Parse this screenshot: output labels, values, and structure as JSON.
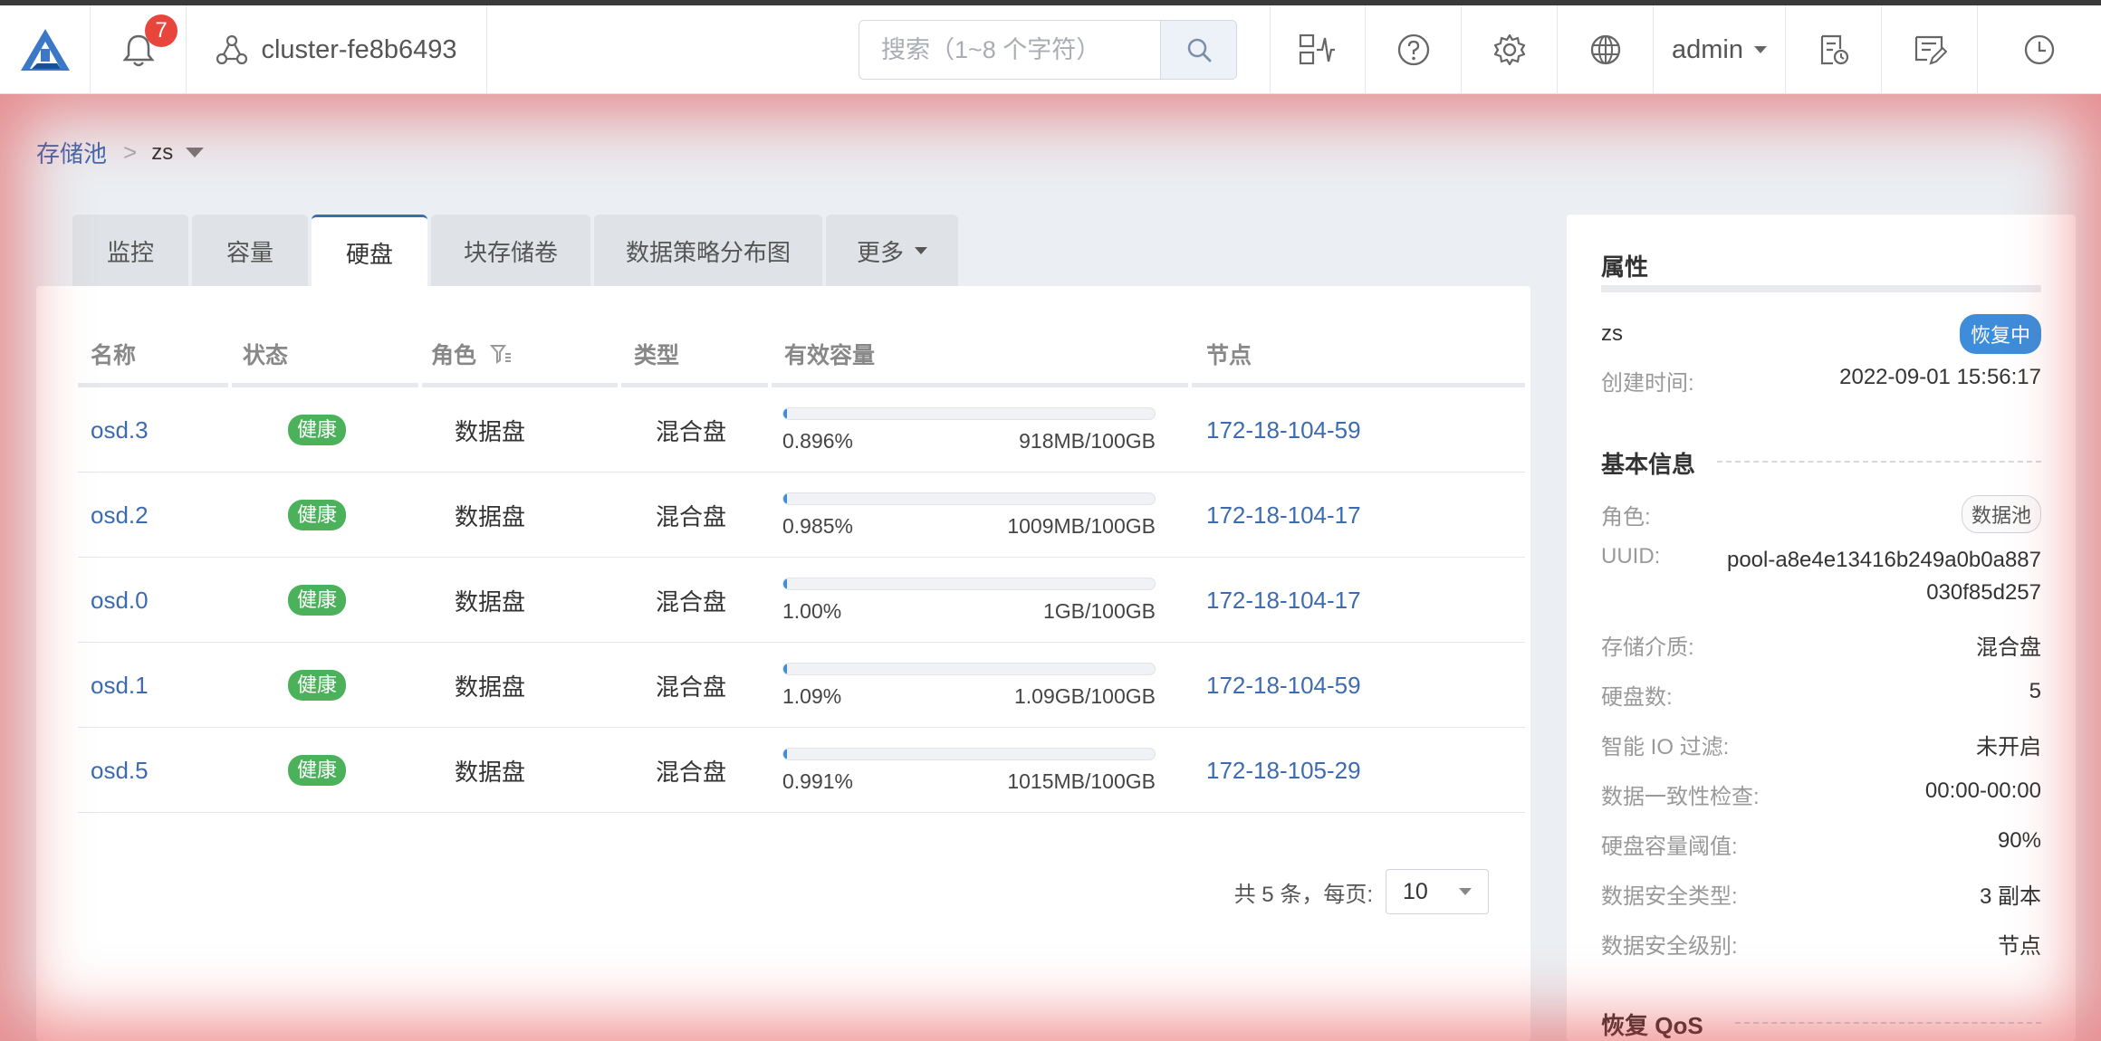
{
  "header": {
    "notification_count": "7",
    "cluster_name": "cluster-fe8b6493",
    "search_placeholder": "搜索（1~8 个字符）",
    "user": "admin"
  },
  "breadcrumb": {
    "parent": "存储池",
    "separator": ">",
    "current": "zs"
  },
  "tabs": [
    {
      "label": "监控"
    },
    {
      "label": "容量"
    },
    {
      "label": "硬盘"
    },
    {
      "label": "块存储卷"
    },
    {
      "label": "数据策略分布图"
    },
    {
      "label": "更多"
    }
  ],
  "active_tab": "硬盘",
  "table": {
    "columns": [
      "名称",
      "状态",
      "角色",
      "类型",
      "有效容量",
      "节点"
    ],
    "rows": [
      {
        "name": "osd.3",
        "status": "健康",
        "role": "数据盘",
        "type": "混合盘",
        "usage_pct": "0.896%",
        "usage_fraction": 0.00896,
        "usage_amount": "918MB/100GB",
        "node": "172-18-104-59"
      },
      {
        "name": "osd.2",
        "status": "健康",
        "role": "数据盘",
        "type": "混合盘",
        "usage_pct": "0.985%",
        "usage_fraction": 0.00985,
        "usage_amount": "1009MB/100GB",
        "node": "172-18-104-17"
      },
      {
        "name": "osd.0",
        "status": "健康",
        "role": "数据盘",
        "type": "混合盘",
        "usage_pct": "1.00%",
        "usage_fraction": 0.01,
        "usage_amount": "1GB/100GB",
        "node": "172-18-104-17"
      },
      {
        "name": "osd.1",
        "status": "健康",
        "role": "数据盘",
        "type": "混合盘",
        "usage_pct": "1.09%",
        "usage_fraction": 0.0109,
        "usage_amount": "1.09GB/100GB",
        "node": "172-18-104-59"
      },
      {
        "name": "osd.5",
        "status": "健康",
        "role": "数据盘",
        "type": "混合盘",
        "usage_pct": "0.991%",
        "usage_fraction": 0.00991,
        "usage_amount": "1015MB/100GB",
        "node": "172-18-105-29"
      }
    ]
  },
  "pagination": {
    "summary": "共 5 条，每页:",
    "page_size": "10"
  },
  "properties": {
    "title": "属性",
    "pool_name": "zs",
    "status_badge": "恢复中",
    "created_label": "创建时间:",
    "created_value": "2022-09-01 15:56:17",
    "basic_title": "基本信息",
    "role_label": "角色:",
    "role_value": "数据池",
    "uuid_label": "UUID:",
    "uuid_line1": "pool-a8e4e13416b249a0b0a887",
    "uuid_line2": "030f85d257",
    "fields": [
      {
        "label": "存储介质:",
        "value": "混合盘"
      },
      {
        "label": "硬盘数:",
        "value": "5"
      },
      {
        "label": "智能 IO 过滤:",
        "value": "未开启"
      },
      {
        "label": "数据一致性检查:",
        "value": "00:00-00:00"
      },
      {
        "label": "硬盘容量阈值:",
        "value": "90%"
      },
      {
        "label": "数据安全类型:",
        "value": "3 副本"
      },
      {
        "label": "数据安全级别:",
        "value": "节点"
      }
    ],
    "qos_title": "恢复 QoS"
  },
  "colors": {
    "brand": "#3d6bb0",
    "healthy": "#4bb25b",
    "recovering": "#3d8ddb",
    "alert": "#e8453c"
  }
}
